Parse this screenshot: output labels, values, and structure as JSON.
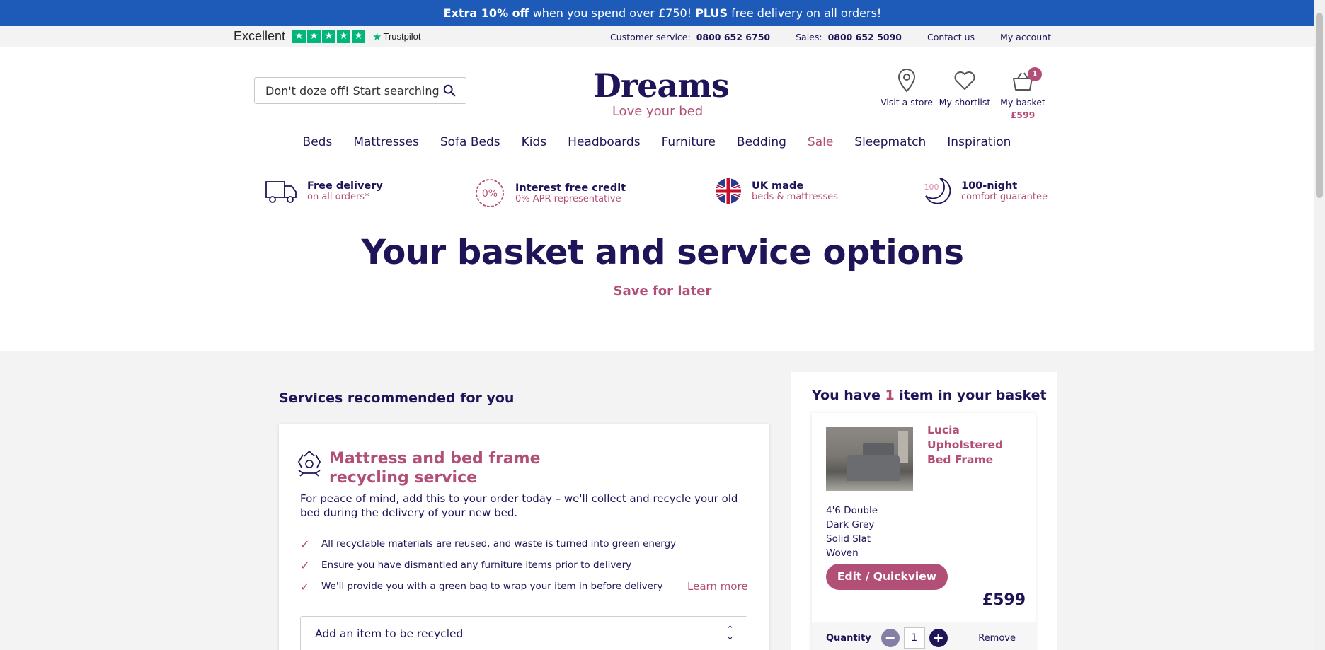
{
  "promo": {
    "part1": "Extra 10% off",
    "part2": " when you spend over £750! ",
    "part3": "PLUS",
    "part4": " free delivery on all orders!"
  },
  "topbar": {
    "trustpilot_rating": "Excellent",
    "trustpilot_brand": "Trustpilot",
    "customer_service_label": "Customer service:",
    "customer_service_number": "0800 652 6750",
    "sales_label": "Sales:",
    "sales_number": "0800 652 5090",
    "contact": "Contact us",
    "account": "My account"
  },
  "header": {
    "search_placeholder": "Don't doze off! Start searching",
    "logo": "Dreams",
    "tagline": "Love your bed",
    "store_label": "Visit a store",
    "shortlist_label": "My shortlist",
    "basket_label": "My basket",
    "basket_count": "1",
    "basket_total": "£599"
  },
  "nav": [
    "Beds",
    "Mattresses",
    "Sofa Beds",
    "Kids",
    "Headboards",
    "Furniture",
    "Bedding",
    "Sale",
    "Sleepmatch",
    "Inspiration"
  ],
  "usps": [
    {
      "title": "Free delivery",
      "sub": "on all orders*"
    },
    {
      "title": "Interest free credit",
      "sub": "0% APR representative"
    },
    {
      "title": "UK made",
      "sub": "beds & mattresses"
    },
    {
      "title": "100-night",
      "sub": "comfort guarantee"
    }
  ],
  "usp_icon_text": {
    "credit": "0%",
    "nights": "100"
  },
  "page": {
    "title": "Your basket and service options",
    "save_later": "Save for later"
  },
  "services": {
    "heading": "Services recommended for you",
    "card_title": "Mattress and bed frame recycling service",
    "description": "For peace of mind, add this to your order today – we'll collect and recycle your old bed during the delivery of your new bed.",
    "checks": [
      "All recyclable materials are reused, and waste is turned into green energy",
      "Ensure you have dismantled any furniture items prior to delivery",
      "We'll provide you with a green bag to wrap your item in before delivery"
    ],
    "learn_more": "Learn more",
    "select_placeholder": "Add an item to be recycled"
  },
  "basket": {
    "heading_pre": "You have ",
    "heading_count": "1",
    "heading_post": " item in your basket",
    "item": {
      "name": "Lucia Upholstered Bed Frame",
      "specs": [
        "4'6 Double",
        "Dark Grey",
        "Solid Slat",
        "Woven"
      ],
      "edit_label": "Edit / Quickview",
      "price": "£599",
      "quantity_label": "Quantity",
      "quantity": "1",
      "remove_label": "Remove"
    }
  },
  "colors": {
    "brand_navy": "#201459",
    "accent_pink": "#b24f77",
    "promo_blue": "#1e5bb8",
    "trustpilot_green": "#00b67a"
  }
}
